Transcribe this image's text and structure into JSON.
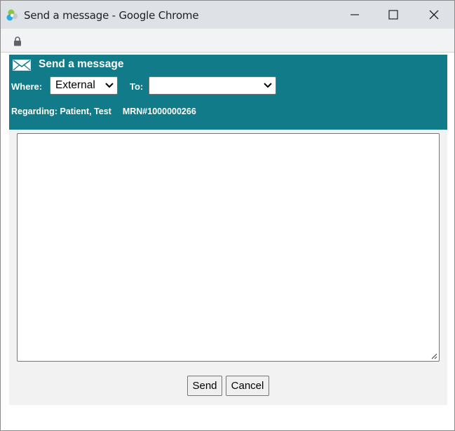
{
  "window": {
    "title": "Send a message - Google Chrome",
    "icons": {
      "app": "chrome-app-icon",
      "minimize": "minimize-icon",
      "maximize": "maximize-icon",
      "close": "close-icon"
    }
  },
  "addressbar": {
    "icon": "lock-icon"
  },
  "header": {
    "icon": "envelope-icon",
    "title": "Send a message",
    "where_label": "Where:",
    "where_value": "External",
    "to_label": "To:",
    "to_value": "",
    "regarding": "Regarding: Patient, Test",
    "mrn": "MRN#1000000266"
  },
  "message": {
    "value": "",
    "placeholder": ""
  },
  "buttons": {
    "send": "Send",
    "cancel": "Cancel"
  },
  "colors": {
    "header_bg": "#117b8a",
    "titlebar_bg": "#dee1e6",
    "panel_bg": "#f2f2f2"
  }
}
